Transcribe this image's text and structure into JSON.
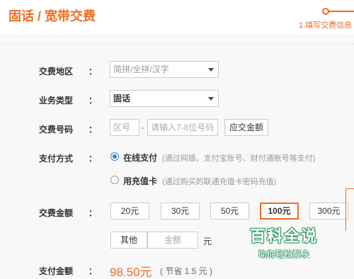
{
  "header": {
    "title": "固话 / 宽带交费",
    "step_label": "1.填写交费信息"
  },
  "form": {
    "region": {
      "label": "交费地区",
      "colon": "：",
      "placeholder": "简拼/全拼/汉字"
    },
    "business": {
      "label": "业务类型",
      "colon": "：",
      "value": "固话"
    },
    "number": {
      "label": "交费号码",
      "colon": "：",
      "area_placeholder": "区号",
      "dash": "-",
      "num_placeholder": "请输入7-8位号码",
      "query_button": "应交金额"
    },
    "payment": {
      "label": "支付方式",
      "colon": "：",
      "options": [
        {
          "label": "在线支付",
          "hint": "(通过网银、支付宝账号、财付通账号等支付)",
          "selected": true
        },
        {
          "label": "用充值卡",
          "hint": "(通过购买的联通充值卡密码充值)",
          "selected": false
        }
      ]
    },
    "amount": {
      "label": "交费金额",
      "colon": "：",
      "options": [
        "20元",
        "30元",
        "50元",
        "100元",
        "300元"
      ],
      "selected": "100元",
      "other_label": "其他",
      "other_placeholder": "金额",
      "unit": "元"
    },
    "total": {
      "label": "支付金额",
      "colon": "：",
      "value": "98.50元",
      "saving": "( 节省 1.5 元 )"
    }
  },
  "watermark": {
    "title": "百科全说",
    "subtitle": "助你轻松解决"
  },
  "colors": {
    "accent": "#f36b21",
    "radio": "#2a87d7"
  }
}
